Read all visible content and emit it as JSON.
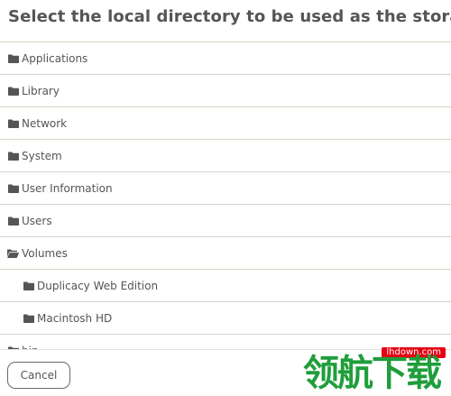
{
  "dialog": {
    "title": "Select the local directory to be used as the storage"
  },
  "directories": [
    {
      "label": "Applications",
      "icon": "folder-icon",
      "expanded": false,
      "indent": 0
    },
    {
      "label": "Library",
      "icon": "folder-icon",
      "expanded": false,
      "indent": 0
    },
    {
      "label": "Network",
      "icon": "folder-icon",
      "expanded": false,
      "indent": 0
    },
    {
      "label": "System",
      "icon": "folder-icon",
      "expanded": false,
      "indent": 0
    },
    {
      "label": "User Information",
      "icon": "folder-icon",
      "expanded": false,
      "indent": 0
    },
    {
      "label": "Users",
      "icon": "folder-icon",
      "expanded": false,
      "indent": 0
    },
    {
      "label": "Volumes",
      "icon": "folder-open-icon",
      "expanded": true,
      "indent": 0
    },
    {
      "label": "Duplicacy Web Edition",
      "icon": "folder-icon",
      "expanded": false,
      "indent": 1
    },
    {
      "label": "Macintosh HD",
      "icon": "folder-icon",
      "expanded": false,
      "indent": 1
    },
    {
      "label": "bin",
      "icon": "folder-icon",
      "expanded": false,
      "indent": 0
    }
  ],
  "footer": {
    "cancel_label": "Cancel"
  },
  "watermark": {
    "site": "lhdown.com",
    "text": "领航下载"
  },
  "colors": {
    "text": "#555555",
    "divider": "#d6d3c8",
    "watermark_green": "#1f9e3b",
    "watermark_red": "#e60012"
  }
}
